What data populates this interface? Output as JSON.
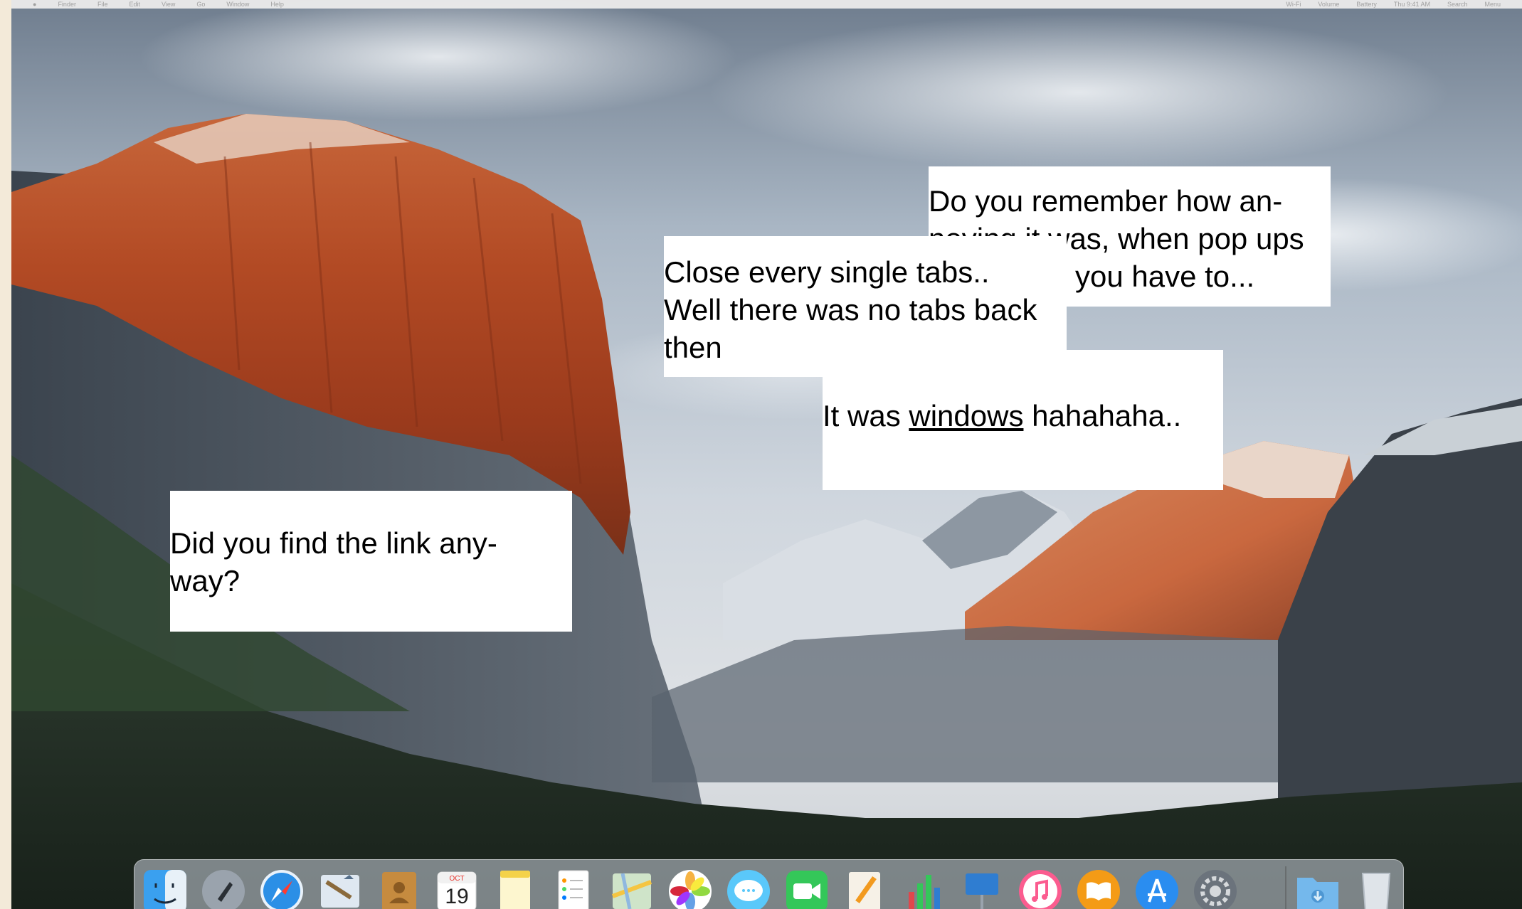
{
  "menubar": {
    "items": [
      "Finder",
      "File",
      "Edit",
      "View",
      "Go",
      "Window",
      "Help"
    ],
    "status": [
      "Wi-Fi",
      "Volume",
      "Battery",
      "Thu 9:41 AM",
      "Search",
      "Menu"
    ]
  },
  "popups": {
    "p1": {
      "line1": "Do you remember how an-",
      "line2_prefix": "noying it ",
      "line2_visible": "was, when pop ups",
      "line3": "you have to..."
    },
    "p2": {
      "line1": "Close every single tabs..",
      "line2": "Well there was no tabs back",
      "line3": "then"
    },
    "p3": {
      "before": "It was ",
      "link": "windows",
      "after": " hahahaha.."
    },
    "p4": {
      "line1": "Did you find the link any-",
      "line2": "way?"
    }
  },
  "dock": {
    "calendar_month": "OCT",
    "calendar_day": "19",
    "apps": [
      "finder-icon",
      "launchpad-icon",
      "safari-icon",
      "mail-icon",
      "contacts-icon",
      "calendar-icon",
      "notes-icon",
      "reminders-icon",
      "maps-icon",
      "photos-icon",
      "messages-icon",
      "facetime-icon",
      "pages-icon",
      "numbers-icon",
      "keynote-icon",
      "itunes-icon",
      "ibooks-icon",
      "app-store-icon",
      "system-preferences-icon",
      "downloads-folder-icon",
      "trash-icon"
    ]
  }
}
